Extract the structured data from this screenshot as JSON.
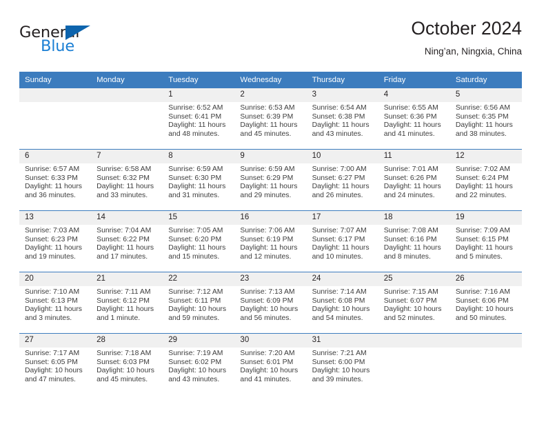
{
  "brand": {
    "name_part1": "General",
    "name_part2": "Blue",
    "triangle_color": "#0d64ad",
    "blue_color": "#1b7fd4"
  },
  "header": {
    "title": "October 2024",
    "subtitle": "Ning’an, Ningxia, China"
  },
  "theme": {
    "header_blue": "#3c7cbe",
    "date_band": "#f0f0f0",
    "text": "#231f20",
    "detail_text": "#3c3c3c"
  },
  "weekday_headers": [
    "Sunday",
    "Monday",
    "Tuesday",
    "Wednesday",
    "Thursday",
    "Friday",
    "Saturday"
  ],
  "labels": {
    "sunrise": "Sunrise:",
    "sunset": "Sunset:",
    "daylight": "Daylight:"
  },
  "weeks": [
    [
      {
        "day": "",
        "empty": true
      },
      {
        "day": "",
        "empty": true
      },
      {
        "day": "1",
        "sunrise": "Sunrise: 6:52 AM",
        "sunset": "Sunset: 6:41 PM",
        "daylight": "Daylight: 11 hours and 48 minutes."
      },
      {
        "day": "2",
        "sunrise": "Sunrise: 6:53 AM",
        "sunset": "Sunset: 6:39 PM",
        "daylight": "Daylight: 11 hours and 45 minutes."
      },
      {
        "day": "3",
        "sunrise": "Sunrise: 6:54 AM",
        "sunset": "Sunset: 6:38 PM",
        "daylight": "Daylight: 11 hours and 43 minutes."
      },
      {
        "day": "4",
        "sunrise": "Sunrise: 6:55 AM",
        "sunset": "Sunset: 6:36 PM",
        "daylight": "Daylight: 11 hours and 41 minutes."
      },
      {
        "day": "5",
        "sunrise": "Sunrise: 6:56 AM",
        "sunset": "Sunset: 6:35 PM",
        "daylight": "Daylight: 11 hours and 38 minutes."
      }
    ],
    [
      {
        "day": "6",
        "sunrise": "Sunrise: 6:57 AM",
        "sunset": "Sunset: 6:33 PM",
        "daylight": "Daylight: 11 hours and 36 minutes."
      },
      {
        "day": "7",
        "sunrise": "Sunrise: 6:58 AM",
        "sunset": "Sunset: 6:32 PM",
        "daylight": "Daylight: 11 hours and 33 minutes."
      },
      {
        "day": "8",
        "sunrise": "Sunrise: 6:59 AM",
        "sunset": "Sunset: 6:30 PM",
        "daylight": "Daylight: 11 hours and 31 minutes."
      },
      {
        "day": "9",
        "sunrise": "Sunrise: 6:59 AM",
        "sunset": "Sunset: 6:29 PM",
        "daylight": "Daylight: 11 hours and 29 minutes."
      },
      {
        "day": "10",
        "sunrise": "Sunrise: 7:00 AM",
        "sunset": "Sunset: 6:27 PM",
        "daylight": "Daylight: 11 hours and 26 minutes."
      },
      {
        "day": "11",
        "sunrise": "Sunrise: 7:01 AM",
        "sunset": "Sunset: 6:26 PM",
        "daylight": "Daylight: 11 hours and 24 minutes."
      },
      {
        "day": "12",
        "sunrise": "Sunrise: 7:02 AM",
        "sunset": "Sunset: 6:24 PM",
        "daylight": "Daylight: 11 hours and 22 minutes."
      }
    ],
    [
      {
        "day": "13",
        "sunrise": "Sunrise: 7:03 AM",
        "sunset": "Sunset: 6:23 PM",
        "daylight": "Daylight: 11 hours and 19 minutes."
      },
      {
        "day": "14",
        "sunrise": "Sunrise: 7:04 AM",
        "sunset": "Sunset: 6:22 PM",
        "daylight": "Daylight: 11 hours and 17 minutes."
      },
      {
        "day": "15",
        "sunrise": "Sunrise: 7:05 AM",
        "sunset": "Sunset: 6:20 PM",
        "daylight": "Daylight: 11 hours and 15 minutes."
      },
      {
        "day": "16",
        "sunrise": "Sunrise: 7:06 AM",
        "sunset": "Sunset: 6:19 PM",
        "daylight": "Daylight: 11 hours and 12 minutes."
      },
      {
        "day": "17",
        "sunrise": "Sunrise: 7:07 AM",
        "sunset": "Sunset: 6:17 PM",
        "daylight": "Daylight: 11 hours and 10 minutes."
      },
      {
        "day": "18",
        "sunrise": "Sunrise: 7:08 AM",
        "sunset": "Sunset: 6:16 PM",
        "daylight": "Daylight: 11 hours and 8 minutes."
      },
      {
        "day": "19",
        "sunrise": "Sunrise: 7:09 AM",
        "sunset": "Sunset: 6:15 PM",
        "daylight": "Daylight: 11 hours and 5 minutes."
      }
    ],
    [
      {
        "day": "20",
        "sunrise": "Sunrise: 7:10 AM",
        "sunset": "Sunset: 6:13 PM",
        "daylight": "Daylight: 11 hours and 3 minutes."
      },
      {
        "day": "21",
        "sunrise": "Sunrise: 7:11 AM",
        "sunset": "Sunset: 6:12 PM",
        "daylight": "Daylight: 11 hours and 1 minute."
      },
      {
        "day": "22",
        "sunrise": "Sunrise: 7:12 AM",
        "sunset": "Sunset: 6:11 PM",
        "daylight": "Daylight: 10 hours and 59 minutes."
      },
      {
        "day": "23",
        "sunrise": "Sunrise: 7:13 AM",
        "sunset": "Sunset: 6:09 PM",
        "daylight": "Daylight: 10 hours and 56 minutes."
      },
      {
        "day": "24",
        "sunrise": "Sunrise: 7:14 AM",
        "sunset": "Sunset: 6:08 PM",
        "daylight": "Daylight: 10 hours and 54 minutes."
      },
      {
        "day": "25",
        "sunrise": "Sunrise: 7:15 AM",
        "sunset": "Sunset: 6:07 PM",
        "daylight": "Daylight: 10 hours and 52 minutes."
      },
      {
        "day": "26",
        "sunrise": "Sunrise: 7:16 AM",
        "sunset": "Sunset: 6:06 PM",
        "daylight": "Daylight: 10 hours and 50 minutes."
      }
    ],
    [
      {
        "day": "27",
        "sunrise": "Sunrise: 7:17 AM",
        "sunset": "Sunset: 6:05 PM",
        "daylight": "Daylight: 10 hours and 47 minutes."
      },
      {
        "day": "28",
        "sunrise": "Sunrise: 7:18 AM",
        "sunset": "Sunset: 6:03 PM",
        "daylight": "Daylight: 10 hours and 45 minutes."
      },
      {
        "day": "29",
        "sunrise": "Sunrise: 7:19 AM",
        "sunset": "Sunset: 6:02 PM",
        "daylight": "Daylight: 10 hours and 43 minutes."
      },
      {
        "day": "30",
        "sunrise": "Sunrise: 7:20 AM",
        "sunset": "Sunset: 6:01 PM",
        "daylight": "Daylight: 10 hours and 41 minutes."
      },
      {
        "day": "31",
        "sunrise": "Sunrise: 7:21 AM",
        "sunset": "Sunset: 6:00 PM",
        "daylight": "Daylight: 10 hours and 39 minutes."
      },
      {
        "day": "",
        "empty": true
      },
      {
        "day": "",
        "empty": true
      }
    ]
  ]
}
